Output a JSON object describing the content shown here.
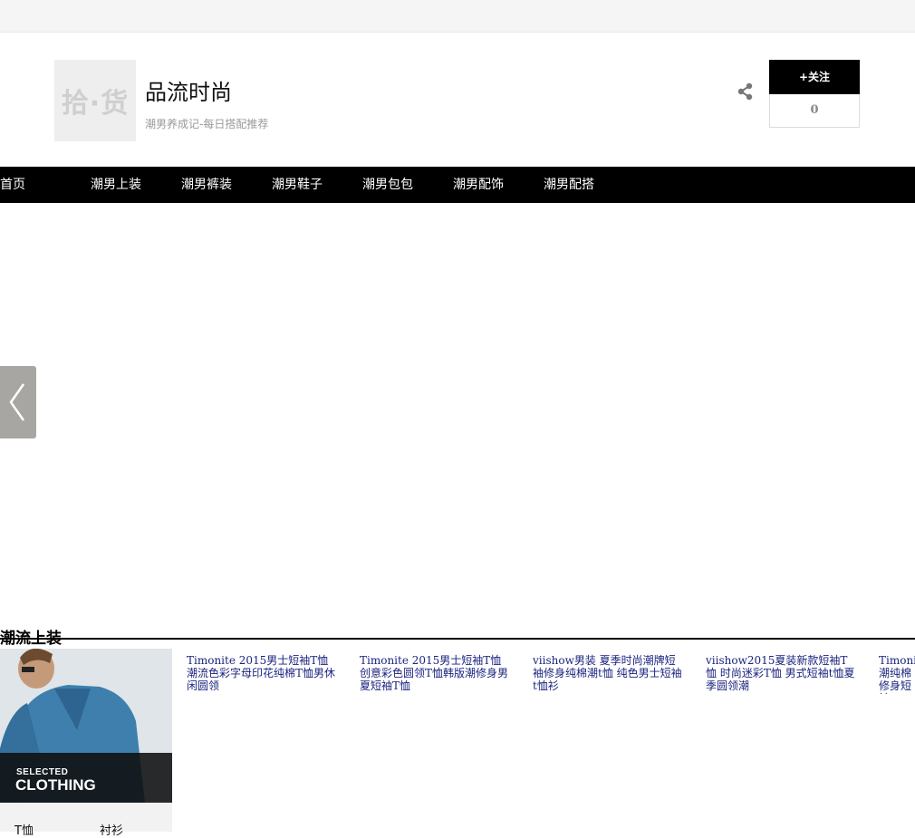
{
  "shop": {
    "logo_text": "拾·货",
    "name": "品流时尚",
    "slogan": "潮男养成记-每日搭配推荐",
    "follow_label": "+关注",
    "follow_count": "0"
  },
  "nav": {
    "items": [
      {
        "label": "首页"
      },
      {
        "label": "潮男上装"
      },
      {
        "label": "潮男裤装"
      },
      {
        "label": "潮男鞋子"
      },
      {
        "label": "潮男包包"
      },
      {
        "label": "潮男配饰"
      },
      {
        "label": "潮男配搭"
      }
    ]
  },
  "section": {
    "title": "潮流上装",
    "banner_small": "SELECTED",
    "banner_big": "CLOTHING",
    "subcategories": [
      {
        "label": "T恤"
      },
      {
        "label": "衬衫"
      }
    ],
    "products": [
      {
        "title": "Timonite 2015男士短袖T恤 潮流色彩字母印花纯棉T恤男休闲圆领"
      },
      {
        "title": "Timonite 2015男士短袖T恤创意彩色圆领T恤韩版潮修身男夏短袖T恤"
      },
      {
        "title": "viishow男装 夏季时尚潮牌短袖修身纯棉潮t恤 纯色男士短袖t恤衫"
      },
      {
        "title": "viishow2015夏装新款短袖T恤 时尚迷彩T恤 男式短袖t恤夏季圆领潮"
      },
      {
        "title": "Timonite 潮纯棉修身短袖"
      }
    ]
  },
  "icons": {
    "share": "share-icon",
    "prev": "chevron-left-icon"
  }
}
